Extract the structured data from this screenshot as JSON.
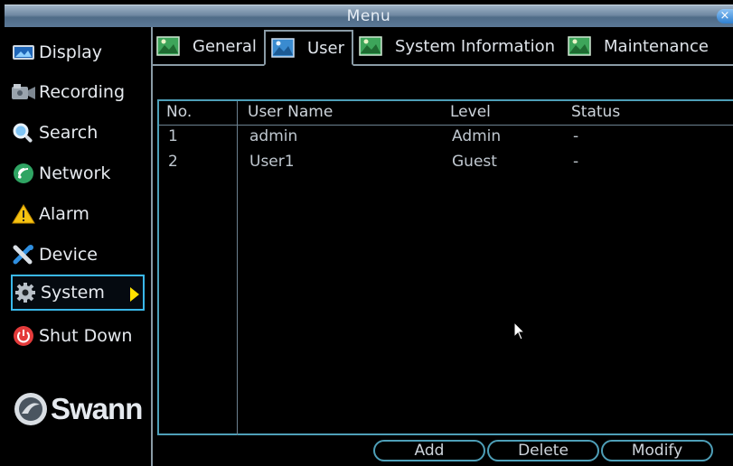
{
  "window": {
    "title": "Menu",
    "close_label": "×"
  },
  "sidebar": {
    "items": [
      {
        "label": "Display",
        "icon": "display-icon"
      },
      {
        "label": "Recording",
        "icon": "recording-icon"
      },
      {
        "label": "Search",
        "icon": "search-icon"
      },
      {
        "label": "Network",
        "icon": "network-icon"
      },
      {
        "label": "Alarm",
        "icon": "alarm-icon"
      },
      {
        "label": "Device",
        "icon": "device-icon"
      },
      {
        "label": "System",
        "icon": "gear-icon",
        "active": true
      },
      {
        "label": "Shut Down",
        "icon": "power-icon"
      }
    ],
    "logo_text": "Swann"
  },
  "tabs": [
    {
      "label": "General"
    },
    {
      "label": "User",
      "active": true
    },
    {
      "label": "System Information"
    },
    {
      "label": "Maintenance"
    }
  ],
  "user_table": {
    "columns": [
      "No.",
      "User Name",
      "Level",
      "Status"
    ],
    "rows": [
      [
        "1",
        "admin",
        "Admin",
        "-"
      ],
      [
        "2",
        "User1",
        "Guest",
        "-"
      ]
    ]
  },
  "buttons": {
    "add": "Add",
    "delete": "Delete",
    "modify": "Modify"
  },
  "colors": {
    "accent": "#3ab8ea",
    "title_bar": "#6f88a2",
    "arrow": "#ffe100"
  }
}
